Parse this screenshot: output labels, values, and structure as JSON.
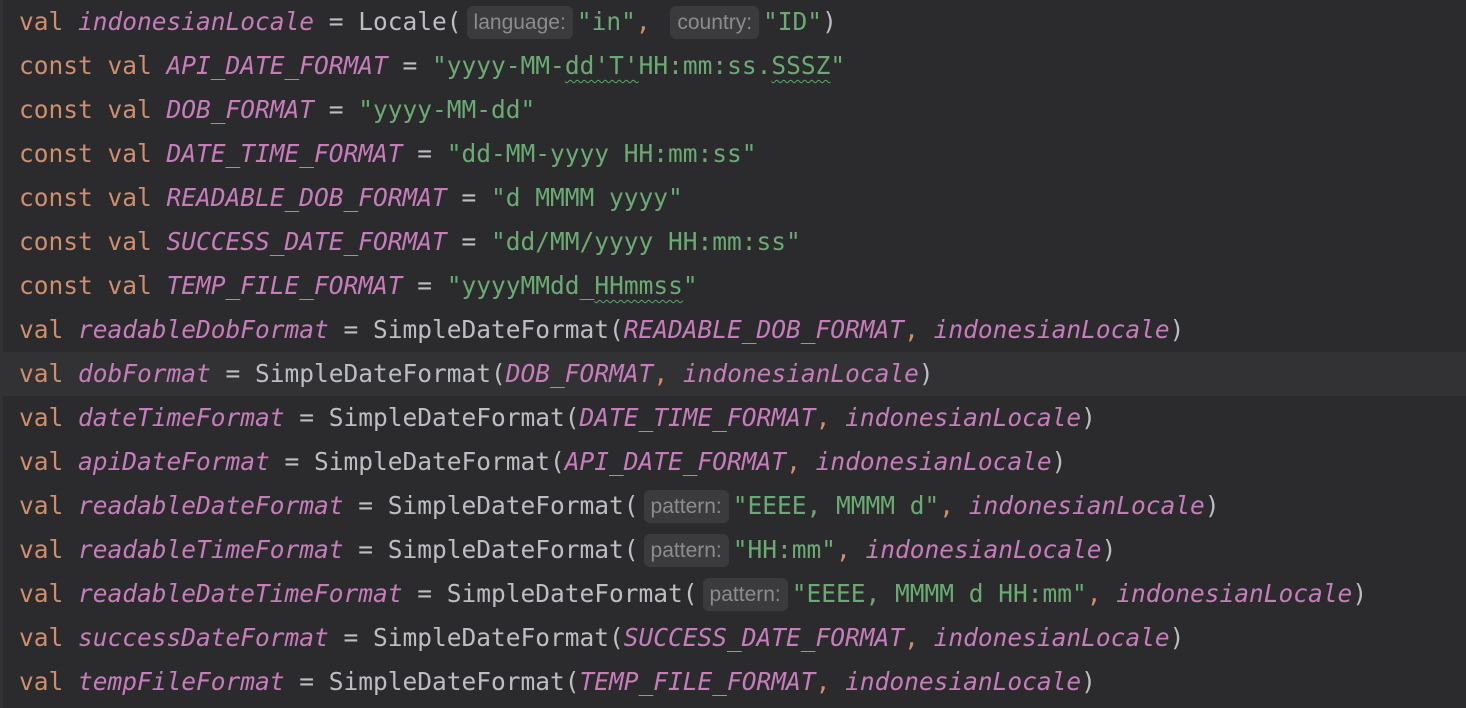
{
  "theme": {
    "background": "#2b2b2d",
    "current_line": "#323235",
    "keyword": "#cf8e6d",
    "property": "#c77dbb",
    "default_text": "#bcbec4",
    "string": "#6aab73",
    "hint_bg": "#3b3b3e",
    "hint_text": "#8c8c90",
    "typo_underline": "#5aa66e"
  },
  "editor": {
    "current_line_index": 8,
    "lines": [
      {
        "tokens": [
          {
            "t": "kw",
            "v": "val "
          },
          {
            "t": "prop",
            "v": "indonesianLocale"
          },
          {
            "t": "plain",
            "v": " = Locale("
          },
          {
            "t": "hint",
            "v": "language:"
          },
          {
            "t": "str",
            "v": "\"in\""
          },
          {
            "t": "kw",
            "v": ", "
          },
          {
            "t": "hint",
            "v": "country:"
          },
          {
            "t": "str",
            "v": "\"ID\""
          },
          {
            "t": "plain",
            "v": ")"
          }
        ]
      },
      {
        "tokens": [
          {
            "t": "kw",
            "v": "const val "
          },
          {
            "t": "prop",
            "v": "API_DATE_FORMAT"
          },
          {
            "t": "plain",
            "v": " = "
          },
          {
            "t": "str",
            "v": "\"yyyy-MM-"
          },
          {
            "t": "str typo",
            "v": "dd'T'"
          },
          {
            "t": "str",
            "v": "HH:mm:ss."
          },
          {
            "t": "str typo",
            "v": "SSSZ"
          },
          {
            "t": "str",
            "v": "\""
          }
        ]
      },
      {
        "tokens": [
          {
            "t": "kw",
            "v": "const val "
          },
          {
            "t": "prop",
            "v": "DOB_FORMAT"
          },
          {
            "t": "plain",
            "v": " = "
          },
          {
            "t": "str",
            "v": "\"yyyy-MM-dd\""
          }
        ]
      },
      {
        "tokens": [
          {
            "t": "kw",
            "v": "const val "
          },
          {
            "t": "prop",
            "v": "DATE_TIME_FORMAT"
          },
          {
            "t": "plain",
            "v": " = "
          },
          {
            "t": "str",
            "v": "\"dd-MM-yyyy HH:mm:ss\""
          }
        ]
      },
      {
        "tokens": [
          {
            "t": "kw",
            "v": "const val "
          },
          {
            "t": "prop",
            "v": "READABLE_DOB_FORMAT"
          },
          {
            "t": "plain",
            "v": " = "
          },
          {
            "t": "str",
            "v": "\"d MMMM yyyy\""
          }
        ]
      },
      {
        "tokens": [
          {
            "t": "kw",
            "v": "const val "
          },
          {
            "t": "prop",
            "v": "SUCCESS_DATE_FORMAT"
          },
          {
            "t": "plain",
            "v": " = "
          },
          {
            "t": "str",
            "v": "\"dd/MM/yyyy HH:mm:ss\""
          }
        ]
      },
      {
        "tokens": [
          {
            "t": "kw",
            "v": "const val "
          },
          {
            "t": "prop",
            "v": "TEMP_FILE_FORMAT"
          },
          {
            "t": "plain",
            "v": " = "
          },
          {
            "t": "str",
            "v": "\"yyyyMMdd_"
          },
          {
            "t": "str typo",
            "v": "HHmmss"
          },
          {
            "t": "str",
            "v": "\""
          }
        ]
      },
      {
        "tokens": [
          {
            "t": "kw",
            "v": "val "
          },
          {
            "t": "prop",
            "v": "readableDobFormat"
          },
          {
            "t": "plain",
            "v": " = SimpleDateFormat("
          },
          {
            "t": "prop",
            "v": "READABLE_DOB_FORMAT"
          },
          {
            "t": "kw",
            "v": ", "
          },
          {
            "t": "prop",
            "v": "indonesianLocale"
          },
          {
            "t": "plain",
            "v": ")"
          }
        ]
      },
      {
        "tokens": [
          {
            "t": "kw",
            "v": "val "
          },
          {
            "t": "prop",
            "v": "dobFormat"
          },
          {
            "t": "plain",
            "v": " = SimpleDateFormat("
          },
          {
            "t": "prop",
            "v": "DOB_FORMAT"
          },
          {
            "t": "kw",
            "v": ", "
          },
          {
            "t": "prop",
            "v": "indonesianLocale"
          },
          {
            "t": "plain",
            "v": ")"
          }
        ]
      },
      {
        "tokens": [
          {
            "t": "kw",
            "v": "val "
          },
          {
            "t": "prop",
            "v": "dateTimeFormat"
          },
          {
            "t": "plain",
            "v": " = SimpleDateFormat("
          },
          {
            "t": "prop",
            "v": "DATE_TIME_FORMAT"
          },
          {
            "t": "kw",
            "v": ", "
          },
          {
            "t": "prop",
            "v": "indonesianLocale"
          },
          {
            "t": "plain",
            "v": ")"
          }
        ]
      },
      {
        "tokens": [
          {
            "t": "kw",
            "v": "val "
          },
          {
            "t": "prop",
            "v": "apiDateFormat"
          },
          {
            "t": "plain",
            "v": " = SimpleDateFormat("
          },
          {
            "t": "prop",
            "v": "API_DATE_FORMAT"
          },
          {
            "t": "kw",
            "v": ", "
          },
          {
            "t": "prop",
            "v": "indonesianLocale"
          },
          {
            "t": "plain",
            "v": ")"
          }
        ]
      },
      {
        "tokens": [
          {
            "t": "kw",
            "v": "val "
          },
          {
            "t": "prop",
            "v": "readableDateFormat"
          },
          {
            "t": "plain",
            "v": " = SimpleDateFormat("
          },
          {
            "t": "hint",
            "v": "pattern:"
          },
          {
            "t": "str",
            "v": "\"EEEE, MMMM d\""
          },
          {
            "t": "kw",
            "v": ", "
          },
          {
            "t": "prop",
            "v": "indonesianLocale"
          },
          {
            "t": "plain",
            "v": ")"
          }
        ]
      },
      {
        "tokens": [
          {
            "t": "kw",
            "v": "val "
          },
          {
            "t": "prop",
            "v": "readableTimeFormat"
          },
          {
            "t": "plain",
            "v": " = SimpleDateFormat("
          },
          {
            "t": "hint",
            "v": "pattern:"
          },
          {
            "t": "str",
            "v": "\"HH:mm\""
          },
          {
            "t": "kw",
            "v": ", "
          },
          {
            "t": "prop",
            "v": "indonesianLocale"
          },
          {
            "t": "plain",
            "v": ")"
          }
        ]
      },
      {
        "tokens": [
          {
            "t": "kw",
            "v": "val "
          },
          {
            "t": "prop",
            "v": "readableDateTimeFormat"
          },
          {
            "t": "plain",
            "v": " = SimpleDateFormat("
          },
          {
            "t": "hint",
            "v": "pattern:"
          },
          {
            "t": "str",
            "v": "\"EEEE, MMMM d HH:mm\""
          },
          {
            "t": "kw",
            "v": ", "
          },
          {
            "t": "prop",
            "v": "indonesianLocale"
          },
          {
            "t": "plain",
            "v": ")"
          }
        ]
      },
      {
        "tokens": [
          {
            "t": "kw",
            "v": "val "
          },
          {
            "t": "prop",
            "v": "successDateFormat"
          },
          {
            "t": "plain",
            "v": " = SimpleDateFormat("
          },
          {
            "t": "prop",
            "v": "SUCCESS_DATE_FORMAT"
          },
          {
            "t": "kw",
            "v": ", "
          },
          {
            "t": "prop",
            "v": "indonesianLocale"
          },
          {
            "t": "plain",
            "v": ")"
          }
        ]
      },
      {
        "tokens": [
          {
            "t": "kw",
            "v": "val "
          },
          {
            "t": "prop",
            "v": "tempFileFormat"
          },
          {
            "t": "plain",
            "v": " = SimpleDateFormat("
          },
          {
            "t": "prop",
            "v": "TEMP_FILE_FORMAT"
          },
          {
            "t": "kw",
            "v": ", "
          },
          {
            "t": "prop",
            "v": "indonesianLocale"
          },
          {
            "t": "plain",
            "v": ")"
          }
        ]
      }
    ]
  }
}
